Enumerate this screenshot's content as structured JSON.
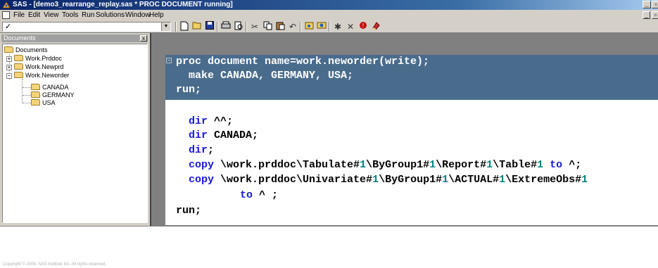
{
  "window": {
    "title": "SAS - [demo3_rearrange_replay.sas *  PROC DOCUMENT running]",
    "min_symbol": "_",
    "restore_symbol": "▫"
  },
  "menu": {
    "items": [
      "File",
      "Edit",
      "View",
      "Tools",
      "Run",
      "Solutions",
      "Window",
      "Help"
    ]
  },
  "toolbar": {
    "command_check": "✓",
    "command_value": "",
    "icons": [
      "new-icon",
      "open-icon",
      "save-icon",
      "print-icon",
      "print-preview-icon",
      "cut-icon",
      "copy-icon",
      "paste-icon",
      "undo-icon",
      "explorer-icon",
      "find-icon",
      "submit-icon",
      "clear-icon",
      "help-icon",
      "library-icon"
    ]
  },
  "explorer": {
    "header": "Documents",
    "close_symbol": "x",
    "tree": {
      "root": "Documents",
      "children": [
        "Work.Prddoc",
        "Work.Newprd",
        "Work.Neworder"
      ],
      "neworder_children": [
        "CANADA",
        "GERMANY",
        "USA"
      ]
    }
  },
  "editor": {
    "fold_symbol": "−",
    "selected_lines": [
      "proc document name=work.neworder(write);",
      "  make CANADA, GERMANY, USA;",
      "run;"
    ],
    "lines": {
      "dir1_kw": "dir",
      "dir1_rest": " ^^;",
      "dir2_kw": "dir",
      "dir2_rest": " CANADA;",
      "dir3_kw": "dir",
      "dir3_rest": ";",
      "copy1_kw": "copy",
      "copy1_a": " \\work.prddoc\\Tabulate#",
      "copy1_n1": "1",
      "copy1_b": "\\ByGroup1#",
      "copy1_n2": "1",
      "copy1_c": "\\Report#",
      "copy1_n3": "1",
      "copy1_d": "\\Table#",
      "copy1_n4": "1",
      "copy1_to": " to",
      "copy1_e": " ^;",
      "copy2_kw": "copy",
      "copy2_a": " \\work.prddoc\\Univariate#",
      "copy2_n1": "1",
      "copy2_b": "\\ByGroup1#",
      "copy2_n2": "1",
      "copy2_c": "\\ACTUAL#",
      "copy2_n3": "1",
      "copy2_d": "\\ExtremeObs#",
      "copy2_n4": "1",
      "copy2_to": "to",
      "copy2_e": " ^ ;",
      "run_kw": "run",
      "run_rest": ";"
    }
  },
  "footer": "Copyright © 2008, SAS Institute Inc. All rights reserved."
}
